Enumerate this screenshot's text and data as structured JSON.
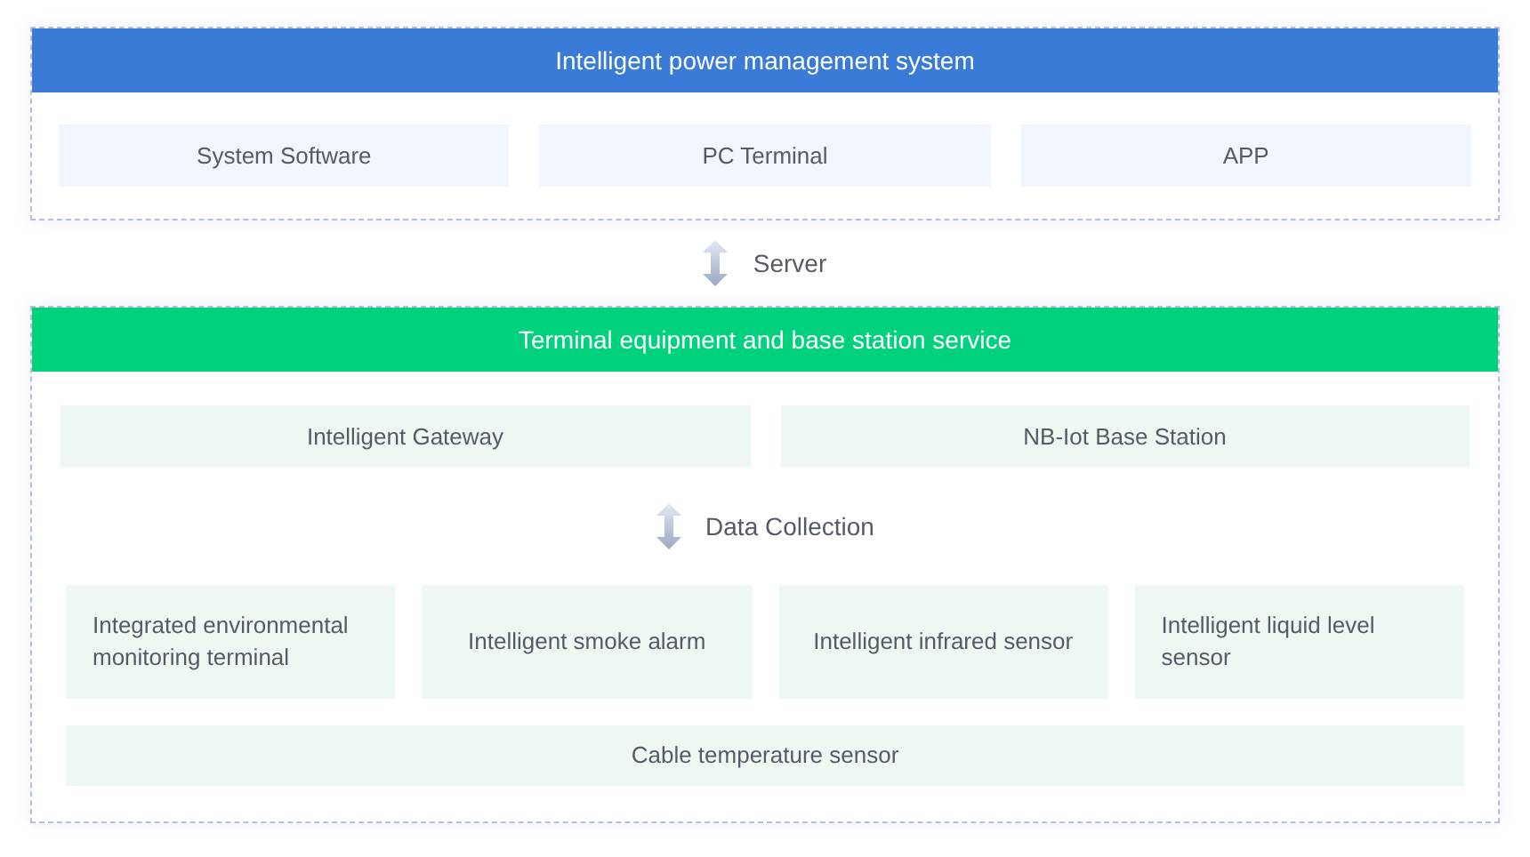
{
  "system_panel": {
    "title": "Intelligent power management system",
    "items": [
      "System Software",
      "PC Terminal",
      "APP"
    ]
  },
  "server_link": {
    "label": "Server"
  },
  "service_panel": {
    "title": "Terminal equipment and base station service",
    "stations": [
      "Intelligent Gateway",
      "NB-Iot Base Station"
    ],
    "collection_link": {
      "label": "Data Collection"
    },
    "sensors": [
      "Integrated environmental monitoring terminal",
      "Intelligent smoke alarm",
      "Intelligent infrared sensor",
      "Intelligent liquid level sensor"
    ],
    "cable_sensor": "Cable temperature sensor"
  }
}
